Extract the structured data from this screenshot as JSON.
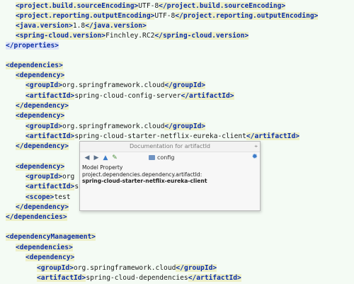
{
  "lines": [
    {
      "parts": [
        [
          "tag",
          "<project.build.sourceEncoding>"
        ],
        [
          "txt",
          "UTF-8"
        ],
        [
          "tag",
          "</project.build.sourceEncoding>"
        ]
      ]
    },
    {
      "parts": [
        [
          "tag",
          "<project.reporting.outputEncoding>"
        ],
        [
          "txt",
          "UTF-8"
        ],
        [
          "tag",
          "</project.reporting.outputEncoding>"
        ]
      ]
    },
    {
      "parts": [
        [
          "tag",
          "<java.version>"
        ],
        [
          "txt",
          "1.8"
        ],
        [
          "tag",
          "</java.version>"
        ]
      ]
    },
    {
      "parts": [
        [
          "tag",
          "<spring-cloud.version>"
        ],
        [
          "txt",
          "Finchley.RC2"
        ],
        [
          "tag",
          "</spring-cloud.version>"
        ]
      ]
    },
    {
      "parts": [
        [
          "ctag",
          "</properties>"
        ]
      ]
    },
    {
      "parts": []
    },
    {
      "parts": [
        [
          "tag",
          "<dependencies>"
        ]
      ]
    },
    {
      "parts": [
        [
          "tag",
          "<dependency>"
        ]
      ]
    },
    {
      "parts": [
        [
          "tag",
          "<groupId>"
        ],
        [
          "txt",
          "org.springframework.cloud"
        ],
        [
          "tag",
          "</groupId>"
        ]
      ]
    },
    {
      "parts": [
        [
          "tag",
          "<artifactId>"
        ],
        [
          "txt",
          "spring-cloud-config-server"
        ],
        [
          "tag",
          "</artifactId>"
        ]
      ]
    },
    {
      "parts": [
        [
          "tag",
          "</dependency>"
        ]
      ]
    },
    {
      "parts": [
        [
          "tag",
          "<dependency>"
        ]
      ]
    },
    {
      "parts": [
        [
          "tag",
          "<groupId>"
        ],
        [
          "txt",
          "org.springframework.cloud"
        ],
        [
          "tag",
          "</groupId>"
        ]
      ]
    },
    {
      "parts": [
        [
          "tag",
          "<artifactId>"
        ],
        [
          "txt",
          "spring-cloud-starter-netflix-eureka-client"
        ],
        [
          "tag",
          "</artifactId>"
        ]
      ]
    },
    {
      "parts": [
        [
          "tag",
          "</dependency>"
        ]
      ]
    },
    {
      "parts": []
    },
    {
      "parts": [
        [
          "tag",
          "<dependency>"
        ]
      ]
    },
    {
      "parts": [
        [
          "tag",
          "<groupId>"
        ],
        [
          "txt",
          "org"
        ]
      ]
    },
    {
      "parts": [
        [
          "tag",
          "<artifactId>"
        ],
        [
          "txt",
          "spr"
        ]
      ]
    },
    {
      "parts": [
        [
          "tag",
          "<scope>"
        ],
        [
          "txt",
          "test"
        ]
      ]
    },
    {
      "parts": [
        [
          "tag",
          "</dependency>"
        ]
      ]
    },
    {
      "parts": [
        [
          "tag",
          "</dependencies>"
        ]
      ]
    },
    {
      "parts": []
    },
    {
      "parts": [
        [
          "tag",
          "<dependencyManagement>"
        ]
      ]
    },
    {
      "parts": [
        [
          "tag",
          "<dependencies>"
        ]
      ]
    },
    {
      "parts": [
        [
          "tag",
          "<dependency>"
        ]
      ]
    },
    {
      "parts": [
        [
          "tag",
          "<groupId>"
        ],
        [
          "txt",
          "org.springframework.cloud"
        ],
        [
          "tag",
          "</groupId>"
        ]
      ]
    },
    {
      "parts": [
        [
          "tag",
          "<artifactId>"
        ],
        [
          "txt",
          "spring-cloud-dependencies"
        ],
        [
          "tag",
          "</artifactId>"
        ]
      ]
    }
  ],
  "popup": {
    "title": "Documentation for artifactId",
    "breadcrumb": "config",
    "model_label": "Model Property",
    "path": "project.dependencies.dependency.artifactId:",
    "value": "spring-cloud-starter-netflix-eureka-client"
  },
  "icons": {
    "back": "arrow-left-icon",
    "forward": "arrow-right-icon",
    "up": "arrow-up-icon",
    "edit": "edit-source-icon",
    "folder": "folder-icon",
    "settings": "gear-icon",
    "pin": "pin-icon"
  }
}
